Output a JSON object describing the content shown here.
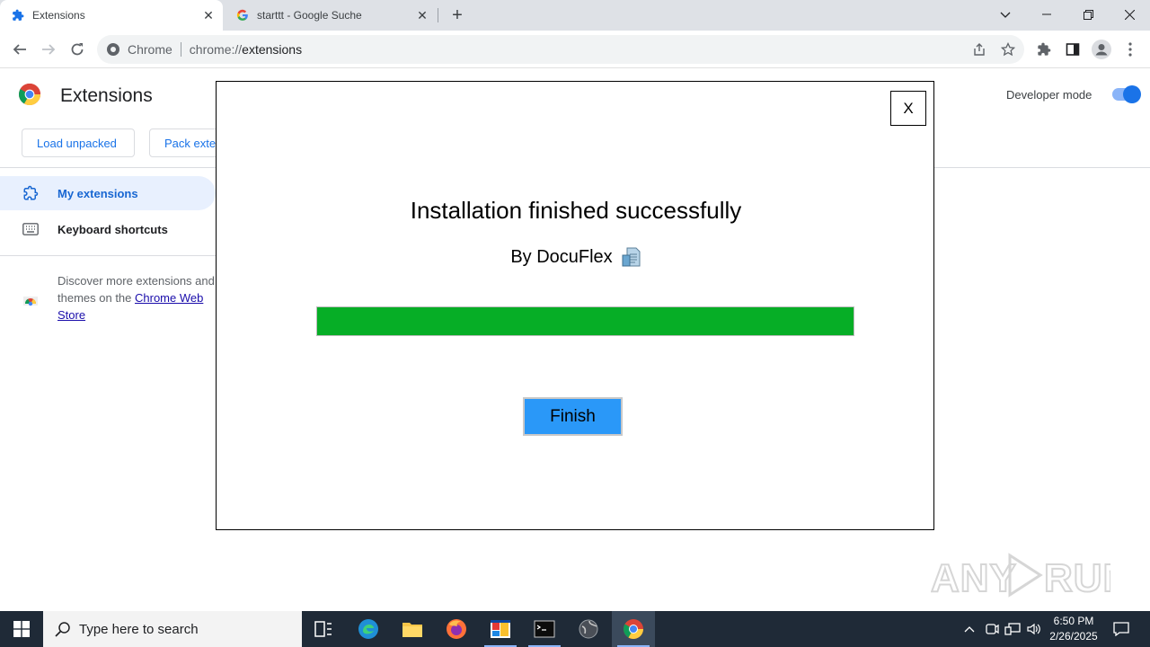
{
  "browser": {
    "tabs": [
      {
        "title": "Extensions",
        "favicon": "puzzle-icon",
        "active": true
      },
      {
        "title": "starttt - Google Suche",
        "favicon": "google-icon",
        "active": false
      }
    ],
    "omnibox": {
      "chip": "Chrome",
      "url_prefix": "chrome://",
      "url_host": "extensions"
    }
  },
  "page": {
    "title": "Extensions",
    "developer_mode_label": "Developer mode",
    "developer_mode_on": true,
    "buttons": {
      "load_unpacked": "Load unpacked",
      "pack_extension": "Pack exte"
    },
    "sidebar": [
      {
        "label": "My extensions",
        "icon": "extension-icon",
        "selected": true
      },
      {
        "label": "Keyboard shortcuts",
        "icon": "keyboard-icon",
        "selected": false
      }
    ],
    "discover": {
      "text": "Discover more extensions and themes on the ",
      "link": "Chrome Web Store"
    }
  },
  "dialog": {
    "close_label": "X",
    "title": "Installation finished successfully",
    "subtitle": "By DocuFlex",
    "progress_percent": 100,
    "progress_color": "#06ae26",
    "finish_label": "Finish"
  },
  "watermark": "ANY RUN",
  "taskbar": {
    "search_placeholder": "Type here to search",
    "time": "6:50 PM",
    "date": "2/26/2025"
  },
  "colors": {
    "accent": "#1a73e8",
    "finish_button": "#2a98f8",
    "taskbar": "#1f2a37"
  }
}
